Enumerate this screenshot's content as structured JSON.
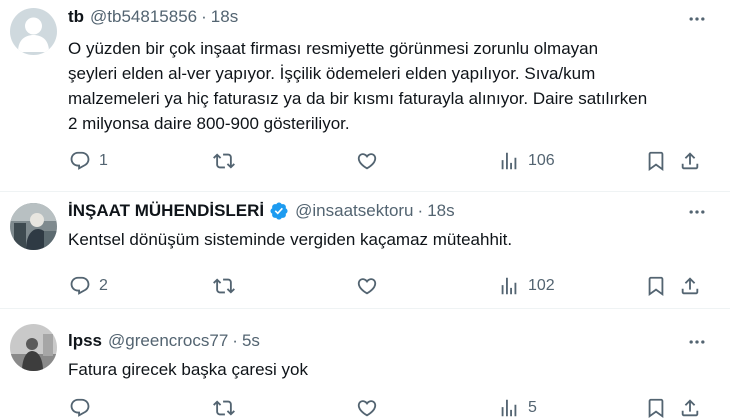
{
  "tweets": [
    {
      "name": "tb",
      "handle": "@tb54815856",
      "separator": "·",
      "time": "18s",
      "verified": false,
      "avatar": "default-avatar",
      "text_lines": [
        "O yüzden bir çok inşaat firması resmiyette görünmesi zorunlu olmayan",
        "şeyleri elden al-ver yapıyor. İşçilik ödemeleri elden yapılıyor. Sıva/kum",
        "malzemeleri ya hiç faturasız ya da bir kısmı faturayla alınıyor. Daire satılırken",
        "2 milyonsa daire 800-900 gösteriliyor."
      ],
      "replies": "1",
      "retweets": "",
      "likes": "",
      "views": "106"
    },
    {
      "name": "İNŞAAT MÜHENDİSLERİ",
      "handle": "@insaatsektoru",
      "separator": "·",
      "time": "18s",
      "verified": true,
      "avatar": "photo-avatar",
      "text_lines": [
        "Kentsel dönüşüm sisteminde vergiden kaçamaz müteahhit."
      ],
      "replies": "2",
      "retweets": "",
      "likes": "",
      "views": "102"
    },
    {
      "name": "lpss",
      "handle": "@greencrocs77",
      "separator": "·",
      "time": "5s",
      "verified": false,
      "avatar": "photo-avatar",
      "text_lines": [
        "Fatura girecek başka çaresi yok"
      ],
      "replies": "",
      "retweets": "",
      "likes": "",
      "views": "5"
    }
  ],
  "colors": {
    "text": "#0f1419",
    "secondary": "#536471",
    "verified": "#1d9bf0",
    "divider": "#eff3f4"
  },
  "icons": [
    "more-icon",
    "reply-icon",
    "retweet-icon",
    "like-icon",
    "views-icon",
    "bookmark-icon",
    "share-icon",
    "verified-badge-icon"
  ]
}
